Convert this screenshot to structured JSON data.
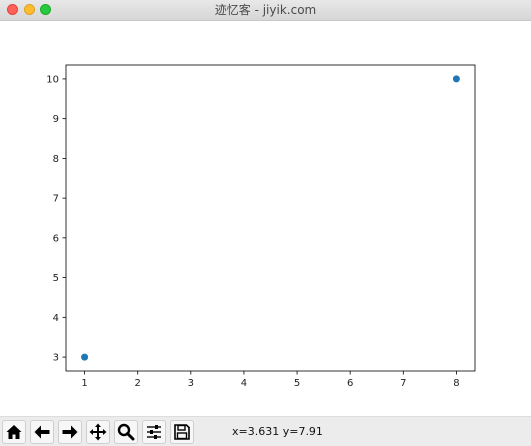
{
  "window": {
    "title": "迹忆客 - jiyik.com"
  },
  "toolbar": {
    "buttons": [
      {
        "name": "home-icon"
      },
      {
        "name": "back-arrow-icon"
      },
      {
        "name": "forward-arrow-icon"
      },
      {
        "name": "pan-move-icon"
      },
      {
        "name": "zoom-magnifier-icon"
      },
      {
        "name": "subplots-config-icon"
      },
      {
        "name": "save-floppy-icon"
      }
    ],
    "coords": "x=3.631 y=7.91"
  },
  "chart_data": {
    "type": "scatter",
    "x": [
      1,
      8
    ],
    "y": [
      3,
      10
    ],
    "xlim": [
      0.65,
      8.35
    ],
    "ylim": [
      2.65,
      10.35
    ],
    "xticks": [
      1,
      2,
      3,
      4,
      5,
      6,
      7,
      8
    ],
    "yticks": [
      3,
      4,
      5,
      6,
      7,
      8,
      9,
      10
    ],
    "marker_color": "#1f77b4",
    "grid": false,
    "title": "",
    "xlabel": "",
    "ylabel": ""
  }
}
